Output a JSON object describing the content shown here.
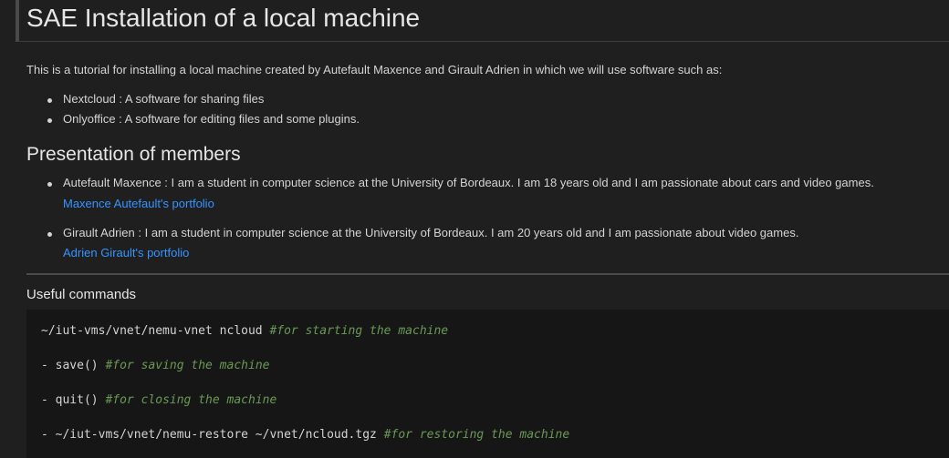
{
  "heading": "SAE Installation of a local machine",
  "intro": "This is a tutorial for installing a local machine created by Autefault Maxence and Girault Adrien in which we will use software such as:",
  "software": [
    "Nextcloud : A software for sharing files",
    "Onlyoffice : A software for editing files and some plugins."
  ],
  "members_heading": "Presentation of members",
  "members": [
    {
      "text": "Autefault Maxence : I am a student in computer science at the University of Bordeaux. I am 18 years old and I am passionate about cars and video games.",
      "link": "Maxence Autefault's portfolio"
    },
    {
      "text": "Girault Adrien : I am a student in computer science at the University of Bordeaux. I am 20 years old and I am passionate about video games.",
      "link": "Adrien Girault's portfolio"
    }
  ],
  "commands_heading": "Useful commands",
  "commands": [
    {
      "code": "~/iut-vms/vnet/nemu-vnet ncloud ",
      "comment": "#for starting the machine"
    },
    {
      "code": "- save() ",
      "comment": "#for saving the machine"
    },
    {
      "code": "- quit() ",
      "comment": "#for closing the machine"
    },
    {
      "code": "- ~/iut-vms/vnet/nemu-restore ~/vnet/ncloud.tgz ",
      "comment": "#for restoring the machine"
    }
  ],
  "colors": {
    "background": "#1f1f1f",
    "link": "#3794ff",
    "comment": "#6a9955",
    "code_background": "#161616"
  }
}
